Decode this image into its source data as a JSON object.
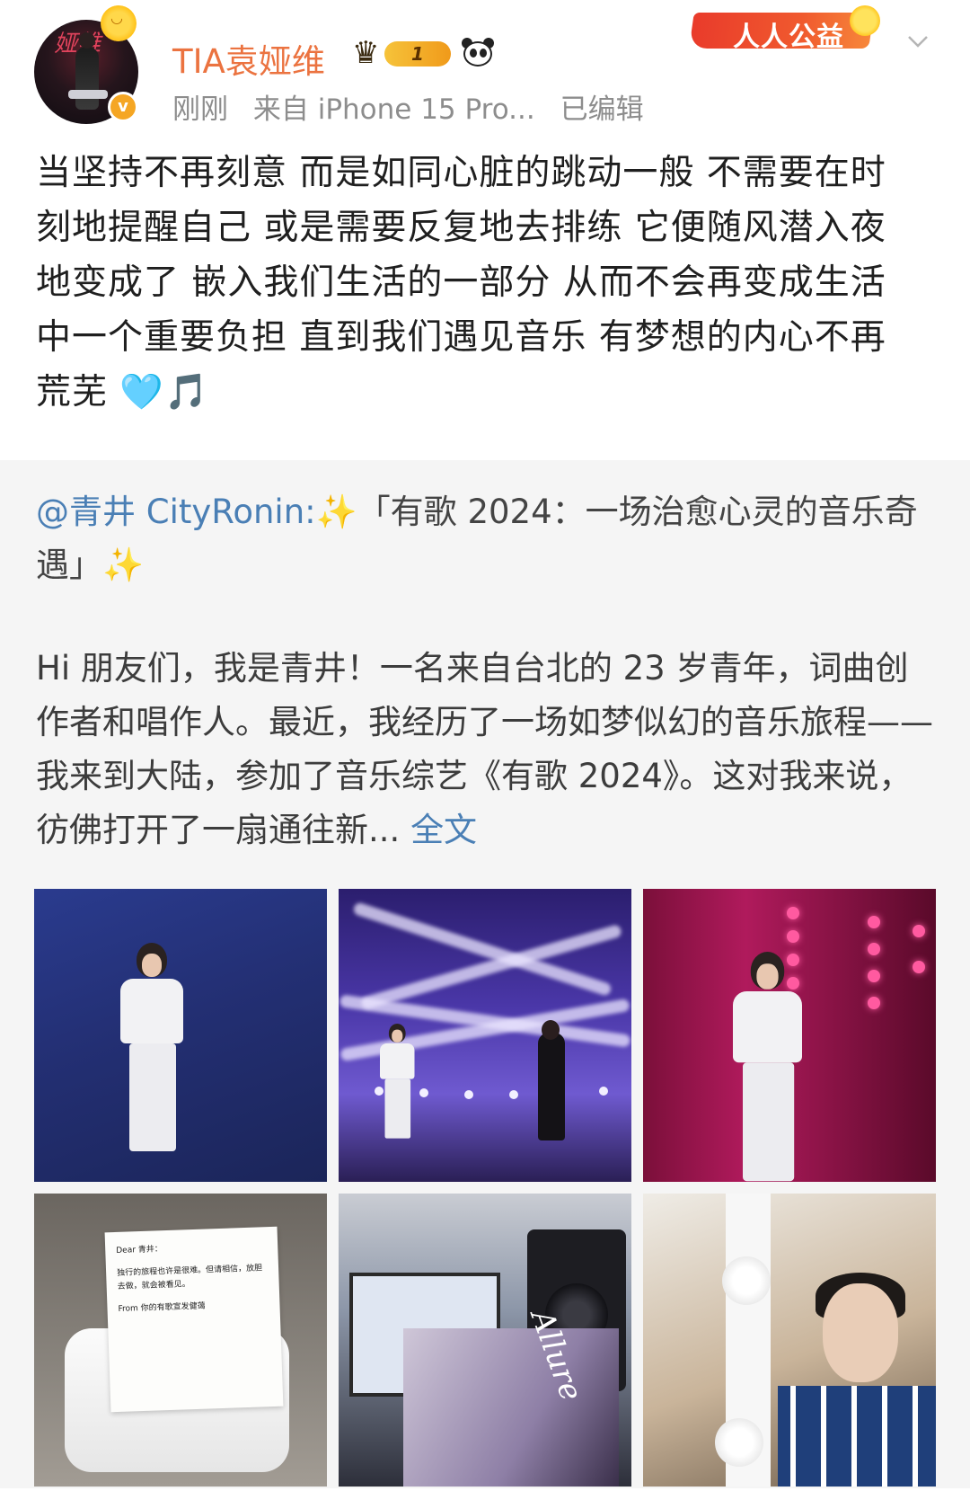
{
  "author": {
    "name": "TIA袁娅维",
    "vip_level": "1",
    "verified_mark": "v",
    "avatar_text": "娅维",
    "icons": [
      "sun-icon",
      "crown-icon",
      "panda-icon",
      "verified-icon"
    ]
  },
  "meta": {
    "time": "刚刚",
    "source": "来自 iPhone 15 Pro...",
    "edited": "已编辑"
  },
  "badge": {
    "label": "人人公益"
  },
  "post": {
    "text": "当坚持不再刻意 而是如同心脏的跳动一般 不需要在时刻地提醒自己 或是需要反复地去排练 它便随风潜入夜地变成了 嵌入我们生活的一部分 从而不会再变成生活中一个重要负担  直到我们遇见音乐 有梦想的内心不再荒芜 🩵🎵"
  },
  "repost": {
    "mention": "@青井 CityRonin:",
    "sparkle": "✨",
    "title": "「有歌 2024：一场治愈心灵的音乐奇遇」",
    "body": "Hi 朋友们，我是青井！一名来自台北的 23 岁青年，词曲创作者和唱作人。最近，我经历了一场如梦似幻的音乐旅程——我来到大陆，参加了音乐综艺《有歌 2024》。这对我来说，彷佛打开了一扇通往新...",
    "fulltext_link": "全文"
  },
  "receipt": {
    "greeting": "Dear 青井：",
    "message": "独行的旅程也许是很难。但请相信，放胆去做，就会被看见。",
    "signature": "From 你的有歌宣发健蔼"
  },
  "album": {
    "cover_text": "Allure"
  },
  "colors": {
    "username": "#eb7340",
    "link": "#4a7fb5",
    "meta": "#8d8d8d",
    "repost_bg": "#f5f5f5",
    "badge": "#e93b2b"
  }
}
